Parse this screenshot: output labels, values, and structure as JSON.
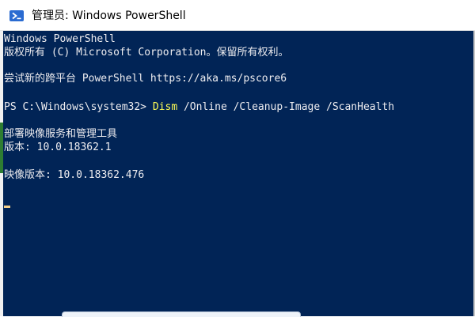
{
  "window": {
    "title": "管理员: Windows PowerShell",
    "icon": "powershell-icon"
  },
  "console": {
    "lines": [
      "Windows PowerShell",
      "版权所有 (C) Microsoft Corporation。保留所有权利。",
      "尝试新的跨平台 PowerShell https://aka.ms/pscore6",
      "部署映像服务和管理工具",
      "版本: 10.0.18362.1",
      "映像版本: 10.0.18362.476"
    ],
    "prompt": "PS C:\\Windows\\system32> ",
    "command": "Dism",
    "command_args": " /Online /Cleanup-Image /ScanHealth"
  },
  "colors": {
    "console_background": "#012456",
    "console_text": "#eeedf0",
    "command_highlight": "#ffff55"
  }
}
